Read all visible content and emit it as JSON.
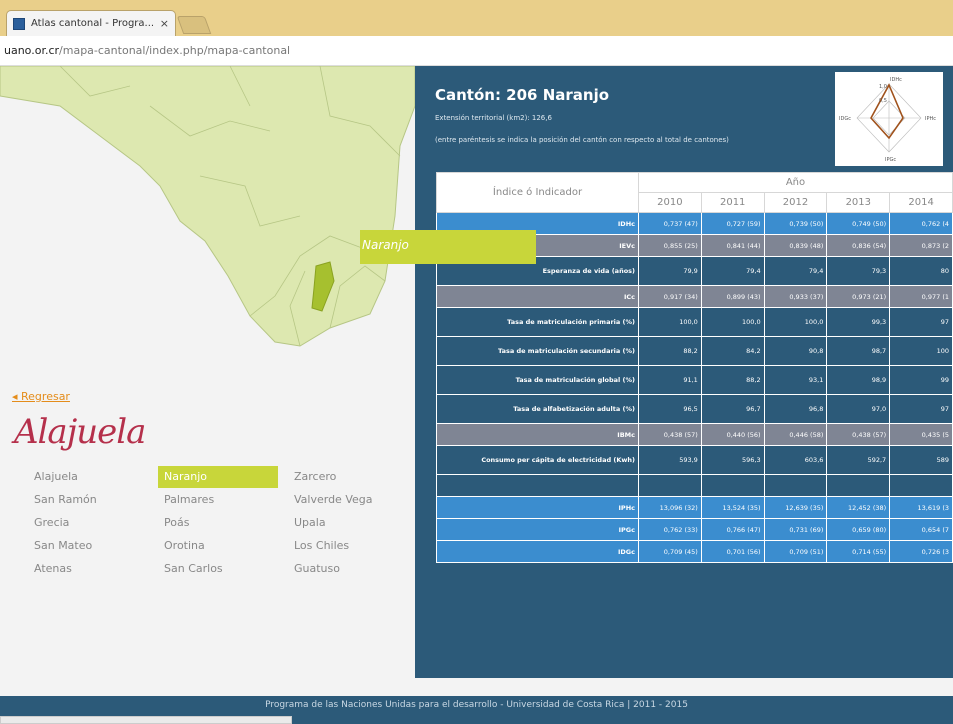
{
  "browser": {
    "tab_title": "Atlas cantonal - Progra...",
    "tab_close": "×",
    "address_domain": "uano.or.cr",
    "address_path": "/mapa-cantonal/index.php/mapa-cantonal"
  },
  "map": {
    "label": "Naranjo",
    "colors": {
      "land": "#dde8b0",
      "highlight": "#a6c02f",
      "border": "#b6c685"
    }
  },
  "sidebar": {
    "back_label": "◂ Regresar",
    "province": "Alajuela",
    "cantons": [
      [
        "Alajuela",
        "Naranjo",
        "Zarcero"
      ],
      [
        "San Ramón",
        "Palmares",
        "Valverde Vega"
      ],
      [
        "Grecia",
        "Poás",
        "Upala"
      ],
      [
        "San Mateo",
        "Orotina",
        "Los Chiles"
      ],
      [
        "Atenas",
        "San Carlos",
        "Guatuso"
      ]
    ],
    "active_canton": "Naranjo"
  },
  "detail": {
    "title": "Cantón: 206 Naranjo",
    "subtitle": "Extensión territorial (km2): 126,6",
    "note": "(entre paréntesis se indica la posición del cantón con respecto al total de cantones)",
    "radar_labels": [
      "IDHc",
      "1,0",
      "0,5",
      "IPHc",
      "IPGc",
      "IDGc"
    ]
  },
  "table": {
    "header_indicator": "Índice ó Indicador",
    "header_year": "Año",
    "years": [
      "2010",
      "2011",
      "2012",
      "2013",
      "2014"
    ],
    "rows": [
      {
        "style": "r-light",
        "label": "IDHc",
        "values": [
          "0,737 (47)",
          "0,727 (59)",
          "0,739 (50)",
          "0,749 (50)",
          "0,762 (4"
        ]
      },
      {
        "style": "r-gray",
        "label": "IEVc",
        "values": [
          "0,855 (25)",
          "0,841 (44)",
          "0,839 (48)",
          "0,836 (54)",
          "0,873 (2"
        ]
      },
      {
        "style": "r-dark",
        "label": "Esperanza de vida (años)",
        "values": [
          "79,9",
          "79,4",
          "79,4",
          "79,3",
          "80"
        ]
      },
      {
        "style": "r-gray",
        "label": "ICc",
        "values": [
          "0,917 (34)",
          "0,899 (43)",
          "0,933 (37)",
          "0,973 (21)",
          "0,977 (1"
        ]
      },
      {
        "style": "r-dark",
        "label": "Tasa de matriculación primaria (%)",
        "values": [
          "100,0",
          "100,0",
          "100,0",
          "99,3",
          "97"
        ]
      },
      {
        "style": "r-dark",
        "label": "Tasa de matriculación secundaria (%)",
        "values": [
          "88,2",
          "84,2",
          "90,8",
          "98,7",
          "100"
        ]
      },
      {
        "style": "r-dark",
        "label": "Tasa de matriculación global (%)",
        "values": [
          "91,1",
          "88,2",
          "93,1",
          "98,9",
          "99"
        ]
      },
      {
        "style": "r-dark",
        "label": "Tasa de alfabetización adulta (%)",
        "values": [
          "96,5",
          "96,7",
          "96,8",
          "97,0",
          "97"
        ]
      },
      {
        "style": "r-gray",
        "label": "IBMc",
        "values": [
          "0,438 (57)",
          "0,440 (56)",
          "0,446 (58)",
          "0,438 (57)",
          "0,435 (5"
        ]
      },
      {
        "style": "r-dark",
        "label": "Consumo per cápita de electricidad (Kwh)",
        "values": [
          "593,9",
          "596,3",
          "603,6",
          "592,7",
          "589"
        ]
      },
      {
        "style": "r-empty",
        "label": "",
        "values": [
          "",
          "",
          "",
          "",
          ""
        ]
      },
      {
        "style": "r-light",
        "label": "IPHc",
        "values": [
          "13,096 (32)",
          "13,524 (35)",
          "12,639 (35)",
          "12,452 (38)",
          "13,619 (3"
        ]
      },
      {
        "style": "r-light",
        "label": "IPGc",
        "values": [
          "0,762 (33)",
          "0,766 (47)",
          "0,731 (69)",
          "0,659 (80)",
          "0,654 (7"
        ]
      },
      {
        "style": "r-light",
        "label": "IDGc",
        "values": [
          "0,709 (45)",
          "0,701 (56)",
          "0,709 (51)",
          "0,714 (55)",
          "0,726 (3"
        ]
      }
    ]
  },
  "footer": {
    "text": "Programa de las Naciones Unidas para el desarrollo - Universidad de Costa Rica | 2011 - 2015"
  }
}
